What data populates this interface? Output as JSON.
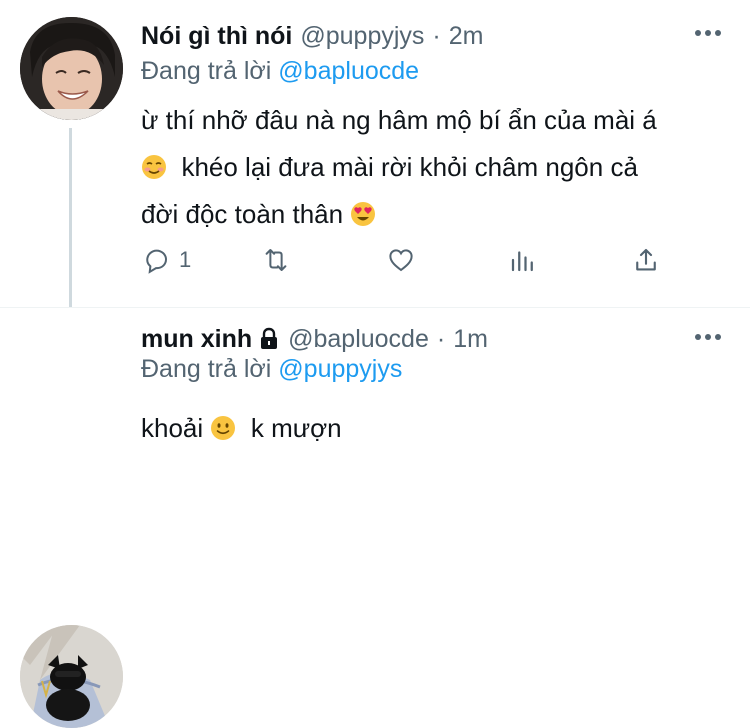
{
  "tweets": [
    {
      "name": "Nói gì thì nói",
      "handle": "@puppyjys",
      "dot": "·",
      "time": "2m",
      "reply_prefix": "Đang trả lời",
      "reply_to": "@bapluocde",
      "line1": "ừ thí nhỡ đâu nà ng hâm mộ bí ẩn của mài á",
      "line2": "khéo lại đưa mài rời khỏi châm ngôn cả",
      "line3": "đời độc toàn thân",
      "reply_count": "1"
    },
    {
      "name": "mun xinh",
      "handle": "@bapluocde",
      "dot": "·",
      "time": "1m",
      "reply_prefix": "Đang trả lời",
      "reply_to": "@puppyjys",
      "word1": "khoải",
      "word2": "k mượn"
    }
  ],
  "colors": {
    "accent": "#1d9bf0",
    "secondary_text": "#536471",
    "thread_line": "#cfd9de"
  },
  "icons": [
    "more-icon",
    "lock-icon",
    "reply-icon",
    "retweet-icon",
    "like-icon",
    "views-icon",
    "share-icon"
  ]
}
